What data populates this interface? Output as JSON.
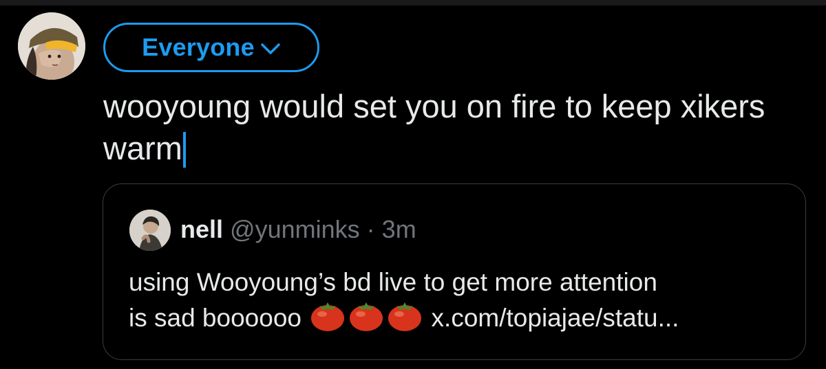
{
  "composer": {
    "audience_label": "Everyone",
    "text": "wooyoung would set you on fire to keep xikers warm",
    "accent_color": "#1d9bf0"
  },
  "quoted_post": {
    "name": "nell",
    "handle": "@yunminks",
    "separator": "·",
    "time": "3m",
    "text_line1": "using Wooyoung’s bd live to get more attention",
    "text_line2": "is sad boooooo",
    "emoji_count": 3,
    "emoji_name": "tomato-emoji",
    "link": "x.com/topiajae/statu..."
  },
  "colors": {
    "background": "#000000",
    "text": "#e7e9ea",
    "secondary_text": "#71767b",
    "card_border": "#3a3d40"
  }
}
